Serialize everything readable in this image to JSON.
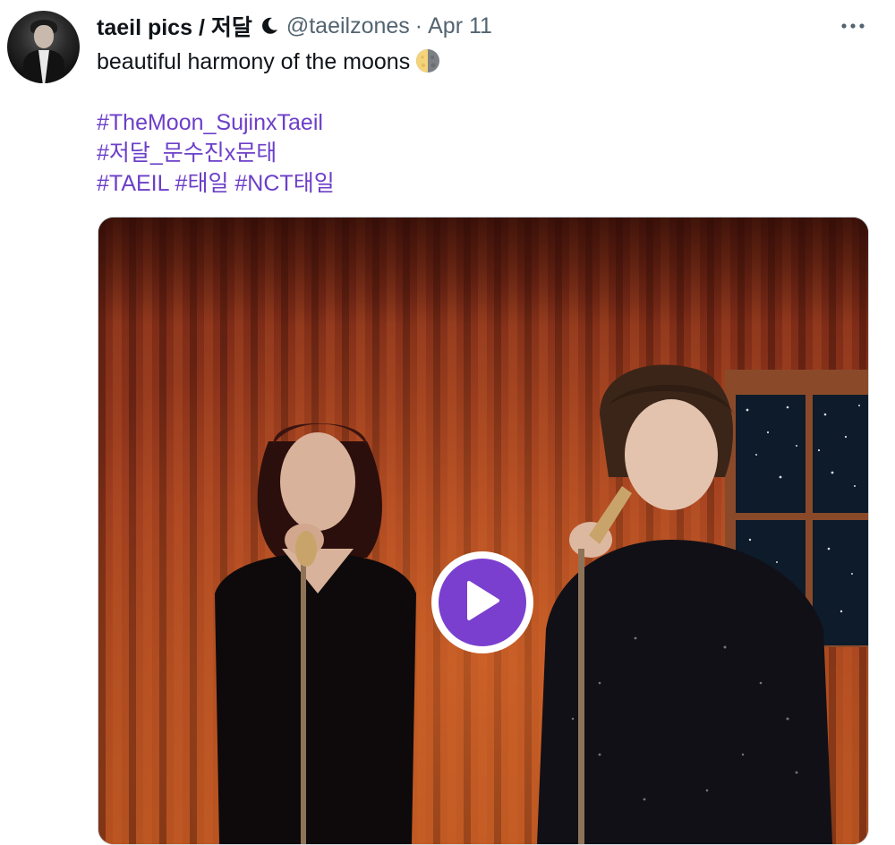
{
  "tweet": {
    "display_name": "taeil pics / 저달",
    "name_icon": "crescent-moon-icon",
    "handle": "@taeilzones",
    "separator": "·",
    "date": "Apr 11",
    "more_icon": "more-horizontal-icon",
    "text": "beautiful harmony of the moons",
    "text_emoji": "half-moon-emoji",
    "hashtag_lines": [
      [
        "#TheMoon_SujinxTaeil"
      ],
      [
        "#저달_문수진x문태"
      ],
      [
        "#TAEIL",
        "#태일",
        "#NCT태일"
      ]
    ]
  },
  "media": {
    "type": "video",
    "play_icon": "play-icon",
    "accent_color": "#7a3fcf"
  },
  "colors": {
    "hashtag": "#6c3fc9",
    "secondary_text": "#536471",
    "primary_text": "#0f1419"
  }
}
